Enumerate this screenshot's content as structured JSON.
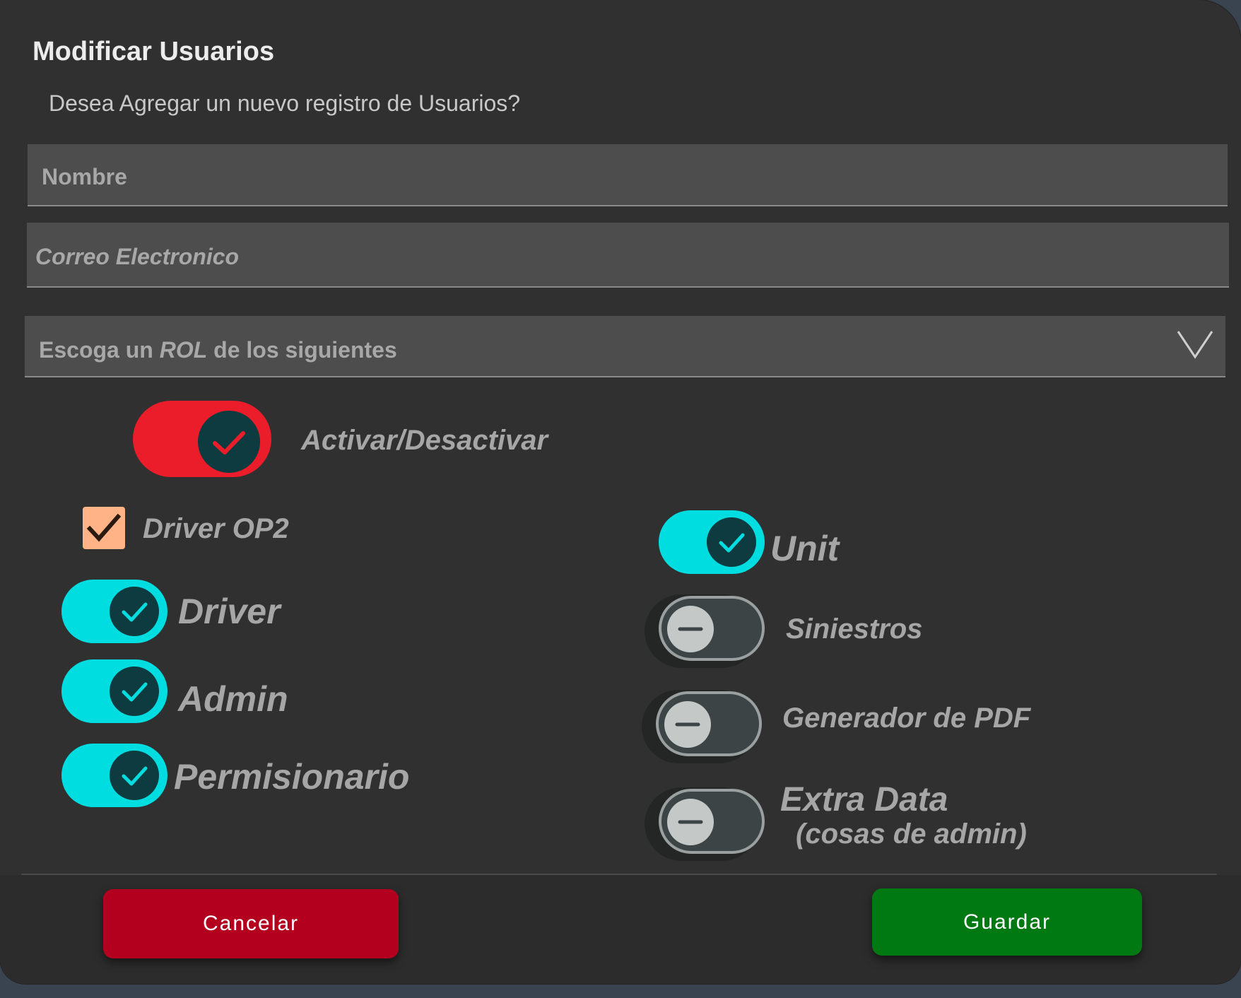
{
  "dialog": {
    "title": "Modificar Usuarios",
    "subtitle": "Desea Agregar un nuevo registro de Usuarios?"
  },
  "form": {
    "nombre_placeholder": "Nombre",
    "correo_placeholder": "Correo Electronico",
    "rol_select": {
      "prefix": "Escoga un ",
      "emphasis": "ROL",
      "suffix": " de los siguientes",
      "icon": "chevron-down-icon"
    }
  },
  "status_toggle": {
    "label": "Activar/Desactivar",
    "checked": true,
    "color": "#ec1d2a"
  },
  "roles_left": {
    "driver_op2": {
      "label": "Driver OP2",
      "checked": true,
      "color": "#ffb386"
    },
    "driver": {
      "label": "Driver",
      "checked": true
    },
    "admin": {
      "label": "Admin",
      "checked": true
    },
    "permisionario": {
      "label": "Permisionario",
      "checked": true
    }
  },
  "roles_right": {
    "unit": {
      "label": "Unit",
      "checked": true
    },
    "siniestros": {
      "label": "Siniestros",
      "checked": false
    },
    "generador_pdf": {
      "label": "Generador de PDF",
      "checked": false
    },
    "extra_data": {
      "label": "Extra Data",
      "sublabel": "(cosas de admin)",
      "checked": false
    }
  },
  "colors": {
    "toggle_on": "#00dde0",
    "toggle_knob": "#0d3b40",
    "cancel": "#b2001e",
    "save": "#007913"
  },
  "footer": {
    "cancel_label": "Cancelar",
    "save_label": "Guardar"
  }
}
